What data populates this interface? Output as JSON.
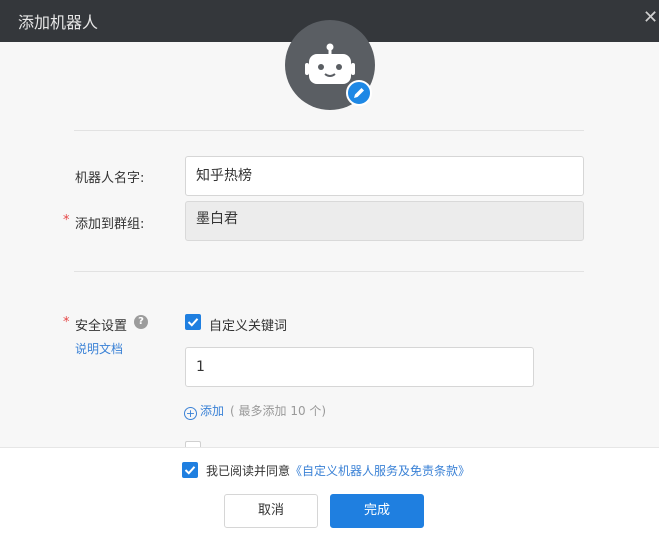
{
  "dialog": {
    "title": "添加机器人",
    "close_icon": "close-icon"
  },
  "avatar": {
    "icon": "robot-icon",
    "edit_icon": "pencil-icon"
  },
  "form": {
    "name_label": "机器人名字:",
    "name_value": "知乎热榜",
    "group_label": "添加到群组:",
    "group_value": "墨白君",
    "required_mark": "*",
    "security_label": "安全设置",
    "help_icon": "?",
    "doc_link": "说明文档",
    "keyword_checkbox_label": "自定义关键词",
    "keyword_checked": true,
    "keyword_value": "1",
    "add_label": "添加",
    "add_hint": "( 最多添加 10 个)",
    "second_option_checked": false
  },
  "footer": {
    "agree_checked": true,
    "agree_text": "我已阅读并同意",
    "agree_link": "《自定义机器人服务及免责条款》",
    "cancel_label": "取消",
    "ok_label": "完成"
  },
  "colors": {
    "accent": "#1f7fe0",
    "titlebar": "#34373b",
    "required": "#e64545"
  }
}
